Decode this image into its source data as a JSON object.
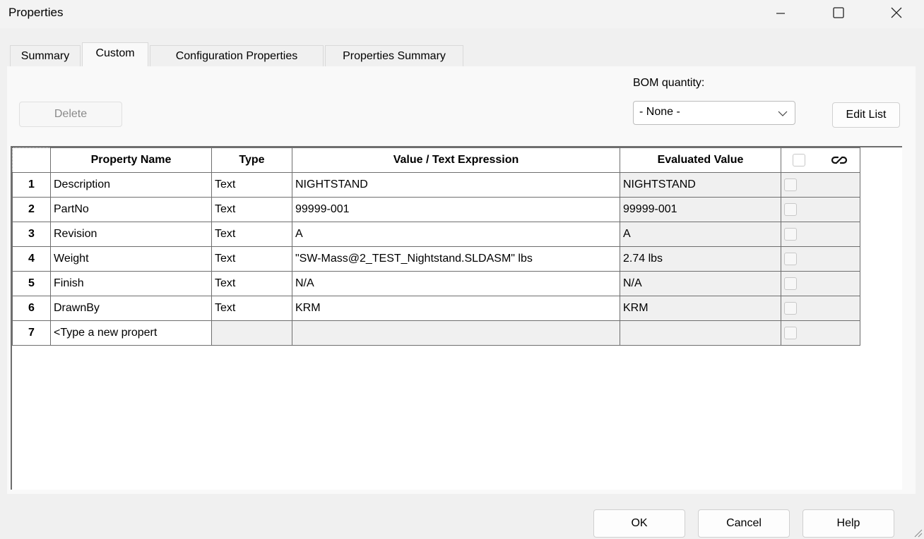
{
  "window": {
    "title": "Properties"
  },
  "tabs": [
    {
      "label": "Summary",
      "active": false
    },
    {
      "label": "Custom",
      "active": true
    },
    {
      "label": "Configuration Properties",
      "active": false
    },
    {
      "label": "Properties Summary",
      "active": false
    }
  ],
  "toolbar": {
    "delete_label": "Delete",
    "bom_label": "BOM quantity:",
    "bom_value": "- None -",
    "edit_list_label": "Edit List"
  },
  "grid": {
    "headers": {
      "property_name": "Property Name",
      "type": "Type",
      "value": "Value / Text Expression",
      "evaluated": "Evaluated Value"
    },
    "rows": [
      {
        "num": "1",
        "name": "Description",
        "type": "Text",
        "value": "NIGHTSTAND",
        "evaluated": "NIGHTSTAND"
      },
      {
        "num": "2",
        "name": "PartNo",
        "type": "Text",
        "value": "99999-001",
        "evaluated": "99999-001"
      },
      {
        "num": "3",
        "name": "Revision",
        "type": "Text",
        "value": "A",
        "evaluated": "A"
      },
      {
        "num": "4",
        "name": "Weight",
        "type": "Text",
        "value": "\"SW-Mass@2_TEST_Nightstand.SLDASM\" lbs",
        "evaluated": "2.74 lbs"
      },
      {
        "num": "5",
        "name": "Finish",
        "type": "Text",
        "value": "N/A",
        "evaluated": "N/A"
      },
      {
        "num": "6",
        "name": "DrawnBy",
        "type": "Text",
        "value": "KRM",
        "evaluated": "KRM"
      },
      {
        "num": "7",
        "name": "<Type a new propert",
        "type": "",
        "value": "",
        "evaluated": ""
      }
    ]
  },
  "footer": {
    "ok_label": "OK",
    "cancel_label": "Cancel",
    "help_label": "Help"
  },
  "icons": {
    "minimize": "minimize-icon",
    "maximize": "maximize-icon",
    "close": "close-icon",
    "link": "link-icon",
    "dropdown": "chevron-down-icon"
  }
}
